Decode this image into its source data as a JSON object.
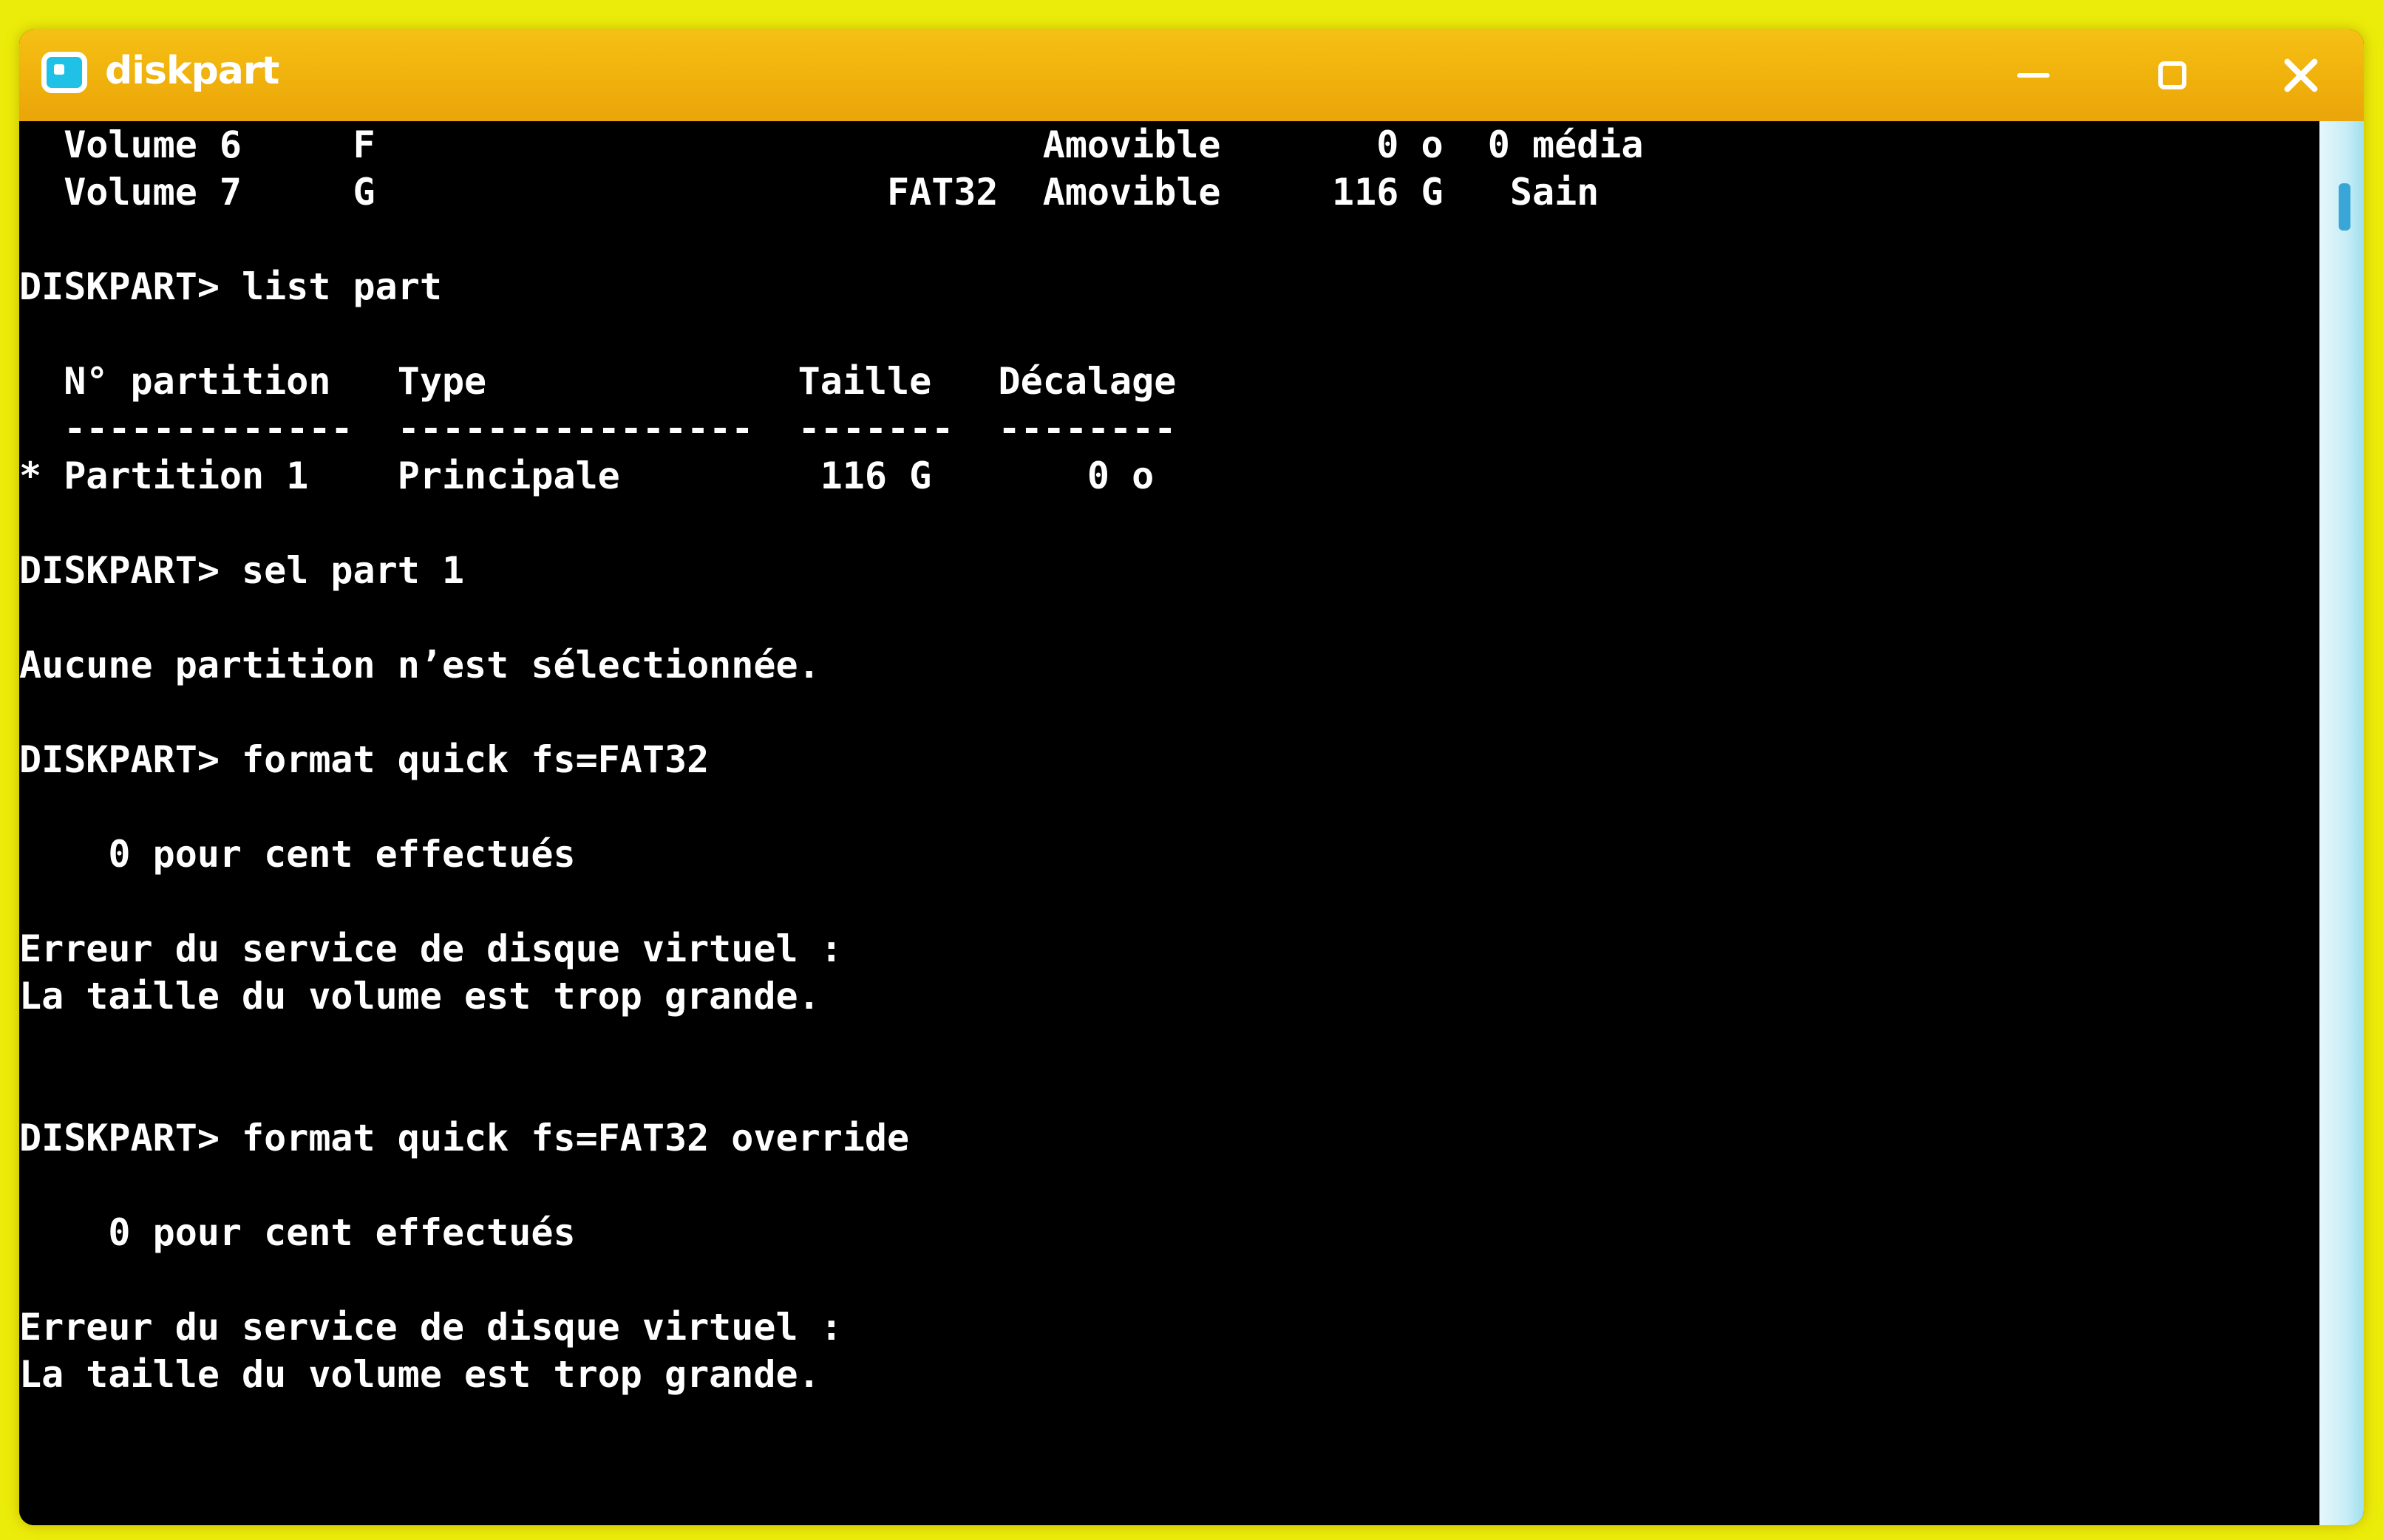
{
  "window": {
    "title": "diskpart"
  },
  "console": {
    "lines": [
      "  Volume 6     F                              Amovible       0 o  0 média",
      "  Volume 7     G                       FAT32  Amovible     116 G   Sain",
      "",
      "DISKPART> list part",
      "",
      "  N° partition   Type              Taille   Décalage",
      "  -------------  ----------------  -------  --------",
      "* Partition 1    Principale         116 G       0 o",
      "",
      "DISKPART> sel part 1",
      "",
      "Aucune partition n’est sélectionnée.",
      "",
      "DISKPART> format quick fs=FAT32",
      "",
      "    0 pour cent effectués",
      "",
      "Erreur du service de disque virtuel :",
      "La taille du volume est trop grande.",
      "",
      "",
      "DISKPART> format quick fs=FAT32 override",
      "",
      "    0 pour cent effectués",
      "",
      "Erreur du service de disque virtuel :",
      "La taille du volume est trop grande."
    ]
  },
  "icons": {
    "app": "terminal-icon",
    "minimize": "minimize-icon",
    "maximize": "maximize-icon",
    "close": "close-icon"
  },
  "colors": {
    "background": "#ecec0a",
    "titlebar": "#f0b10c",
    "console_bg": "#000000",
    "console_text": "#ffffff",
    "scrollbar": "#c8edf6"
  }
}
